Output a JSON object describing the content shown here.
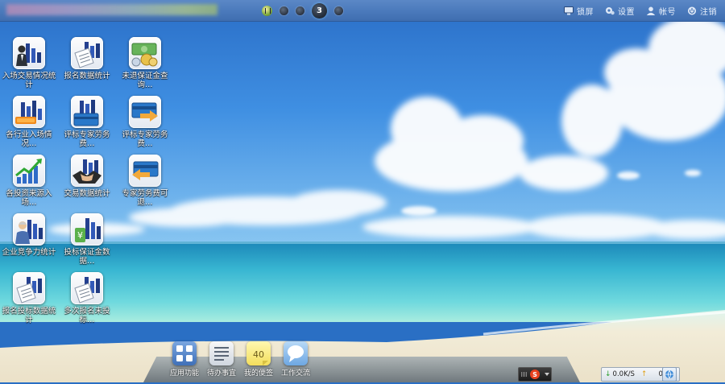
{
  "topbar": {
    "pager": {
      "current_page": "3"
    },
    "tools": [
      {
        "label": "锁屏",
        "icon": "monitor-icon"
      },
      {
        "label": "设置",
        "icon": "settings-icon"
      },
      {
        "label": "帐号",
        " icon": "user-icon"
      },
      {
        "label": "注销",
        "icon": "power-icon"
      }
    ]
  },
  "desktop": {
    "icons": [
      {
        "label": "入场交易情况统计",
        "icon": "person-chart-icon"
      },
      {
        "label": "报名数据统计",
        "icon": "document-chart-icon"
      },
      {
        "label": "未退保证金查询…",
        "icon": "money-icon"
      },
      {
        "label": "各行业入场情况…",
        "icon": "bar-chart-icon"
      },
      {
        "label": "评标专家劳务费…",
        "icon": "card-chart-icon"
      },
      {
        "label": "评标专家劳务费…",
        "icon": "card-arrow-icon"
      },
      {
        "label": "各投资来源入场…",
        "icon": "growth-chart-icon"
      },
      {
        "label": "交易数据统计",
        "icon": "handshake-icon"
      },
      {
        "label": "专家劳务费可退…",
        "icon": "card-arrow-back-icon"
      },
      {
        "label": "企业竞争力统计",
        "icon": "person-chart-icon"
      },
      {
        "label": "投标保证金数据…",
        "icon": "money-bars-icon"
      },
      {
        "label": "报名投标数据统计",
        "icon": "document-chart-icon"
      },
      {
        "label": "多次报名未投标…",
        "icon": "document-chart-icon"
      }
    ]
  },
  "dock": {
    "apps": [
      {
        "label": "应用功能",
        "icon": "apps-grid-icon"
      },
      {
        "label": "待办事宜",
        "icon": "todo-list-icon"
      },
      {
        "label": "我的便签",
        "icon": "sticky-note-icon"
      },
      {
        "label": "工作交流",
        "icon": "chat-bubble-icon"
      }
    ],
    "sticky_text": "40"
  },
  "tray": {
    "download_speed": "0.0K/S",
    "upload_speed": "0K/S"
  },
  "colors": {
    "topbar": "#4a79bb",
    "sky": "#2f7fd6",
    "sea": "#38c4d8",
    "sand": "#f1ead9"
  }
}
